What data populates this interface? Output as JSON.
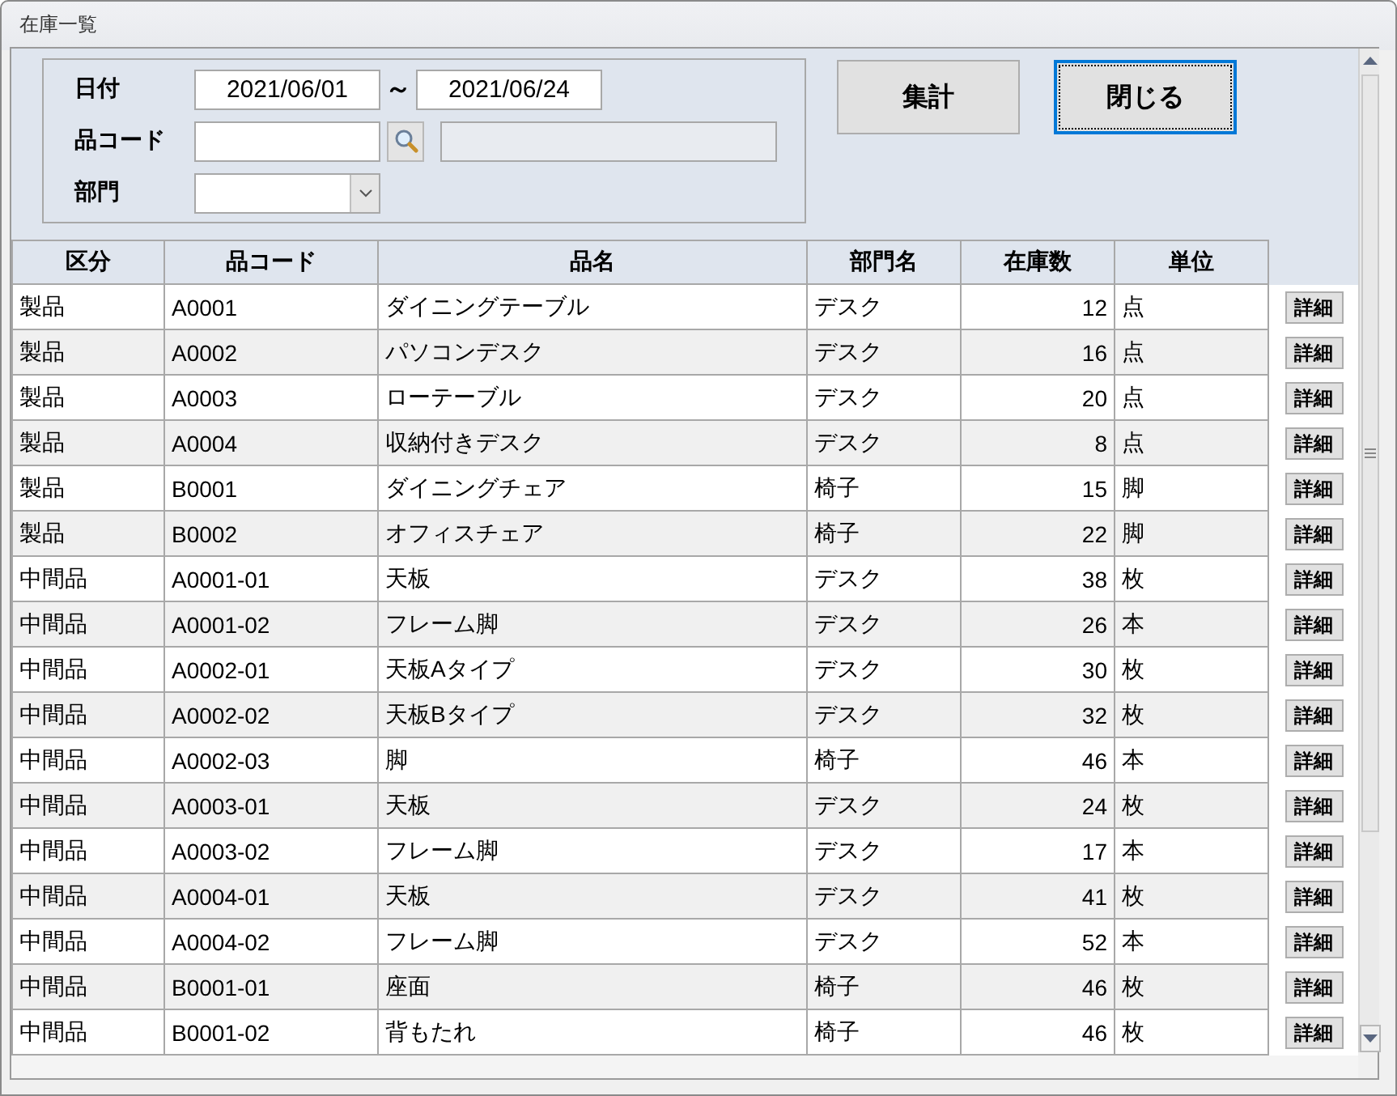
{
  "window": {
    "title": "在庫一覧"
  },
  "filter": {
    "date_label": "日付",
    "date_from": "2021/06/01",
    "range_sep": "～",
    "date_to": "2021/06/24",
    "code_label": "品コード",
    "dept_label": "部門"
  },
  "buttons": [
    {
      "label": "集計",
      "focused": false
    },
    {
      "label": "閉じる",
      "focused": true
    }
  ],
  "table": {
    "columns": [
      "区分",
      "品コード",
      "品名",
      "部門名",
      "在庫数",
      "単位"
    ],
    "rows": [
      {
        "cells": [
          "製品",
          "A0001",
          "ダイニングテーブル",
          "デスク",
          "12",
          "点"
        ],
        "action": "詳細"
      },
      {
        "cells": [
          "製品",
          "A0002",
          "パソコンデスク",
          "デスク",
          "16",
          "点"
        ],
        "action": "詳細"
      },
      {
        "cells": [
          "製品",
          "A0003",
          "ローテーブル",
          "デスク",
          "20",
          "点"
        ],
        "action": "詳細"
      },
      {
        "cells": [
          "製品",
          "A0004",
          "収納付きデスク",
          "デスク",
          "8",
          "点"
        ],
        "action": "詳細"
      },
      {
        "cells": [
          "製品",
          "B0001",
          "ダイニングチェア",
          "椅子",
          "15",
          "脚"
        ],
        "action": "詳細"
      },
      {
        "cells": [
          "製品",
          "B0002",
          "オフィスチェア",
          "椅子",
          "22",
          "脚"
        ],
        "action": "詳細"
      },
      {
        "cells": [
          "中間品",
          "A0001-01",
          "天板",
          "デスク",
          "38",
          "枚"
        ],
        "action": "詳細"
      },
      {
        "cells": [
          "中間品",
          "A0001-02",
          "フレーム脚",
          "デスク",
          "26",
          "本"
        ],
        "action": "詳細"
      },
      {
        "cells": [
          "中間品",
          "A0002-01",
          "天板Aタイプ",
          "デスク",
          "30",
          "枚"
        ],
        "action": "詳細"
      },
      {
        "cells": [
          "中間品",
          "A0002-02",
          "天板Bタイプ",
          "デスク",
          "32",
          "枚"
        ],
        "action": "詳細"
      },
      {
        "cells": [
          "中間品",
          "A0002-03",
          "脚",
          "椅子",
          "46",
          "本"
        ],
        "action": "詳細"
      },
      {
        "cells": [
          "中間品",
          "A0003-01",
          "天板",
          "デスク",
          "24",
          "枚"
        ],
        "action": "詳細"
      },
      {
        "cells": [
          "中間品",
          "A0003-02",
          "フレーム脚",
          "デスク",
          "17",
          "本"
        ],
        "action": "詳細"
      },
      {
        "cells": [
          "中間品",
          "A0004-01",
          "天板",
          "デスク",
          "41",
          "枚"
        ],
        "action": "詳細"
      },
      {
        "cells": [
          "中間品",
          "A0004-02",
          "フレーム脚",
          "デスク",
          "52",
          "本"
        ],
        "action": "詳細"
      },
      {
        "cells": [
          "中間品",
          "B0001-01",
          "座面",
          "椅子",
          "46",
          "枚"
        ],
        "action": "詳細"
      },
      {
        "cells": [
          "中間品",
          "B0001-02",
          "背もたれ",
          "椅子",
          "46",
          "枚"
        ],
        "action": "詳細"
      }
    ]
  }
}
